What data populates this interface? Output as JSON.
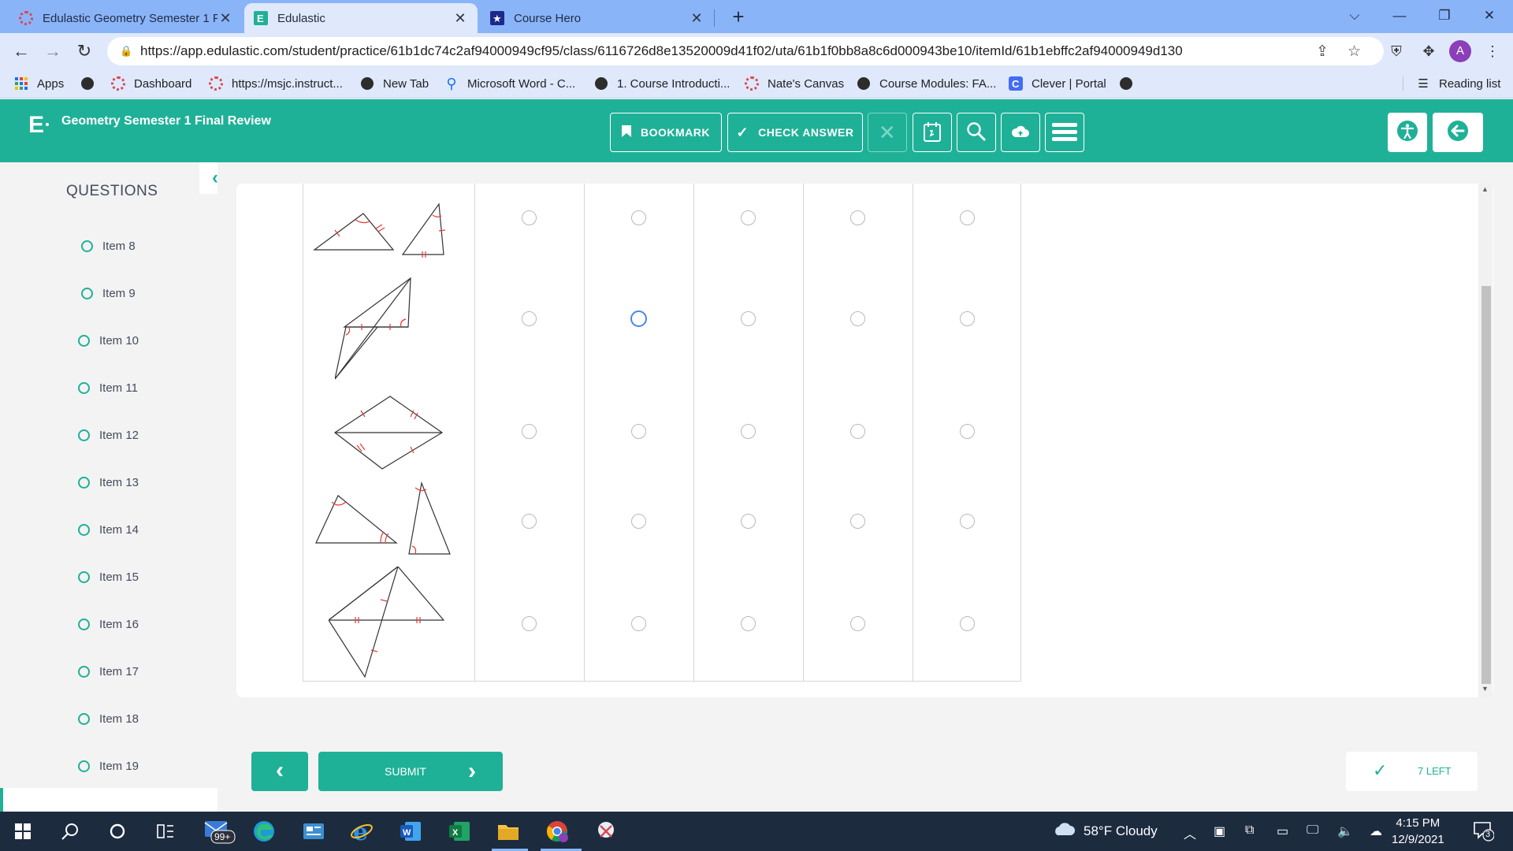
{
  "browser": {
    "tabs": [
      {
        "title": "Edulastic Geometry Semester 1 F",
        "active": false
      },
      {
        "title": "Edulastic",
        "active": true
      },
      {
        "title": "Course Hero",
        "active": false
      }
    ],
    "url": "https://app.edulastic.com/student/practice/61b1dc74c2af94000949cf95/class/6116726d8e13520009d41f02/uta/61b1f0bb8a8c6d000943be10/itemId/61b1ebffc2af94000949d130",
    "profile_initial": "A",
    "bookmarks": [
      {
        "label": "Apps",
        "icon": "apps-grid-icon"
      },
      {
        "label": "",
        "icon": "globe-icon"
      },
      {
        "label": "Dashboard",
        "icon": "canvas-icon"
      },
      {
        "label": "https://msjc.instruct...",
        "icon": "canvas-icon"
      },
      {
        "label": "New Tab",
        "icon": "globe-icon"
      },
      {
        "label": "Microsoft Word - C...",
        "icon": "location-pin-icon"
      },
      {
        "label": "1. Course Introducti...",
        "icon": "globe-icon"
      },
      {
        "label": "Nate's Canvas",
        "icon": "canvas-icon"
      },
      {
        "label": "Course Modules: FA...",
        "icon": "globe-icon"
      },
      {
        "label": "Clever | Portal",
        "icon": "clever-icon"
      },
      {
        "label": "",
        "icon": "globe-icon"
      }
    ],
    "reading_list": "Reading list"
  },
  "header": {
    "logo": "E",
    "title": "Geometry Semester 1 Final Review",
    "bookmark_label": "BOOKMARK",
    "check_answer_label": "CHECK ANSWER"
  },
  "sidebar": {
    "title": "QUESTIONS",
    "items": [
      "Item 8",
      "Item 9",
      "Item 10",
      "Item 11",
      "Item 12",
      "Item 13",
      "Item 14",
      "Item 15",
      "Item 16",
      "Item 17",
      "Item 18",
      "Item 19"
    ]
  },
  "question": {
    "row_count": 5,
    "column_count": 5,
    "selected": [
      {
        "row": 2,
        "column": 2
      }
    ]
  },
  "footer": {
    "submit_label": "SUBMIT",
    "remaining_label": "7 LEFT"
  },
  "taskbar": {
    "mail_badge": "99+",
    "weather": "58°F  Cloudy",
    "time": "4:15 PM",
    "date": "12/9/2021",
    "notification_count": "3"
  },
  "colors": {
    "accent": "#1fb197",
    "browser_tab_bar": "#8ab4f8",
    "taskbar": "#1d2b3f",
    "selected_radio": "#4a86e8",
    "figure_tick_marks": "#e53935"
  }
}
